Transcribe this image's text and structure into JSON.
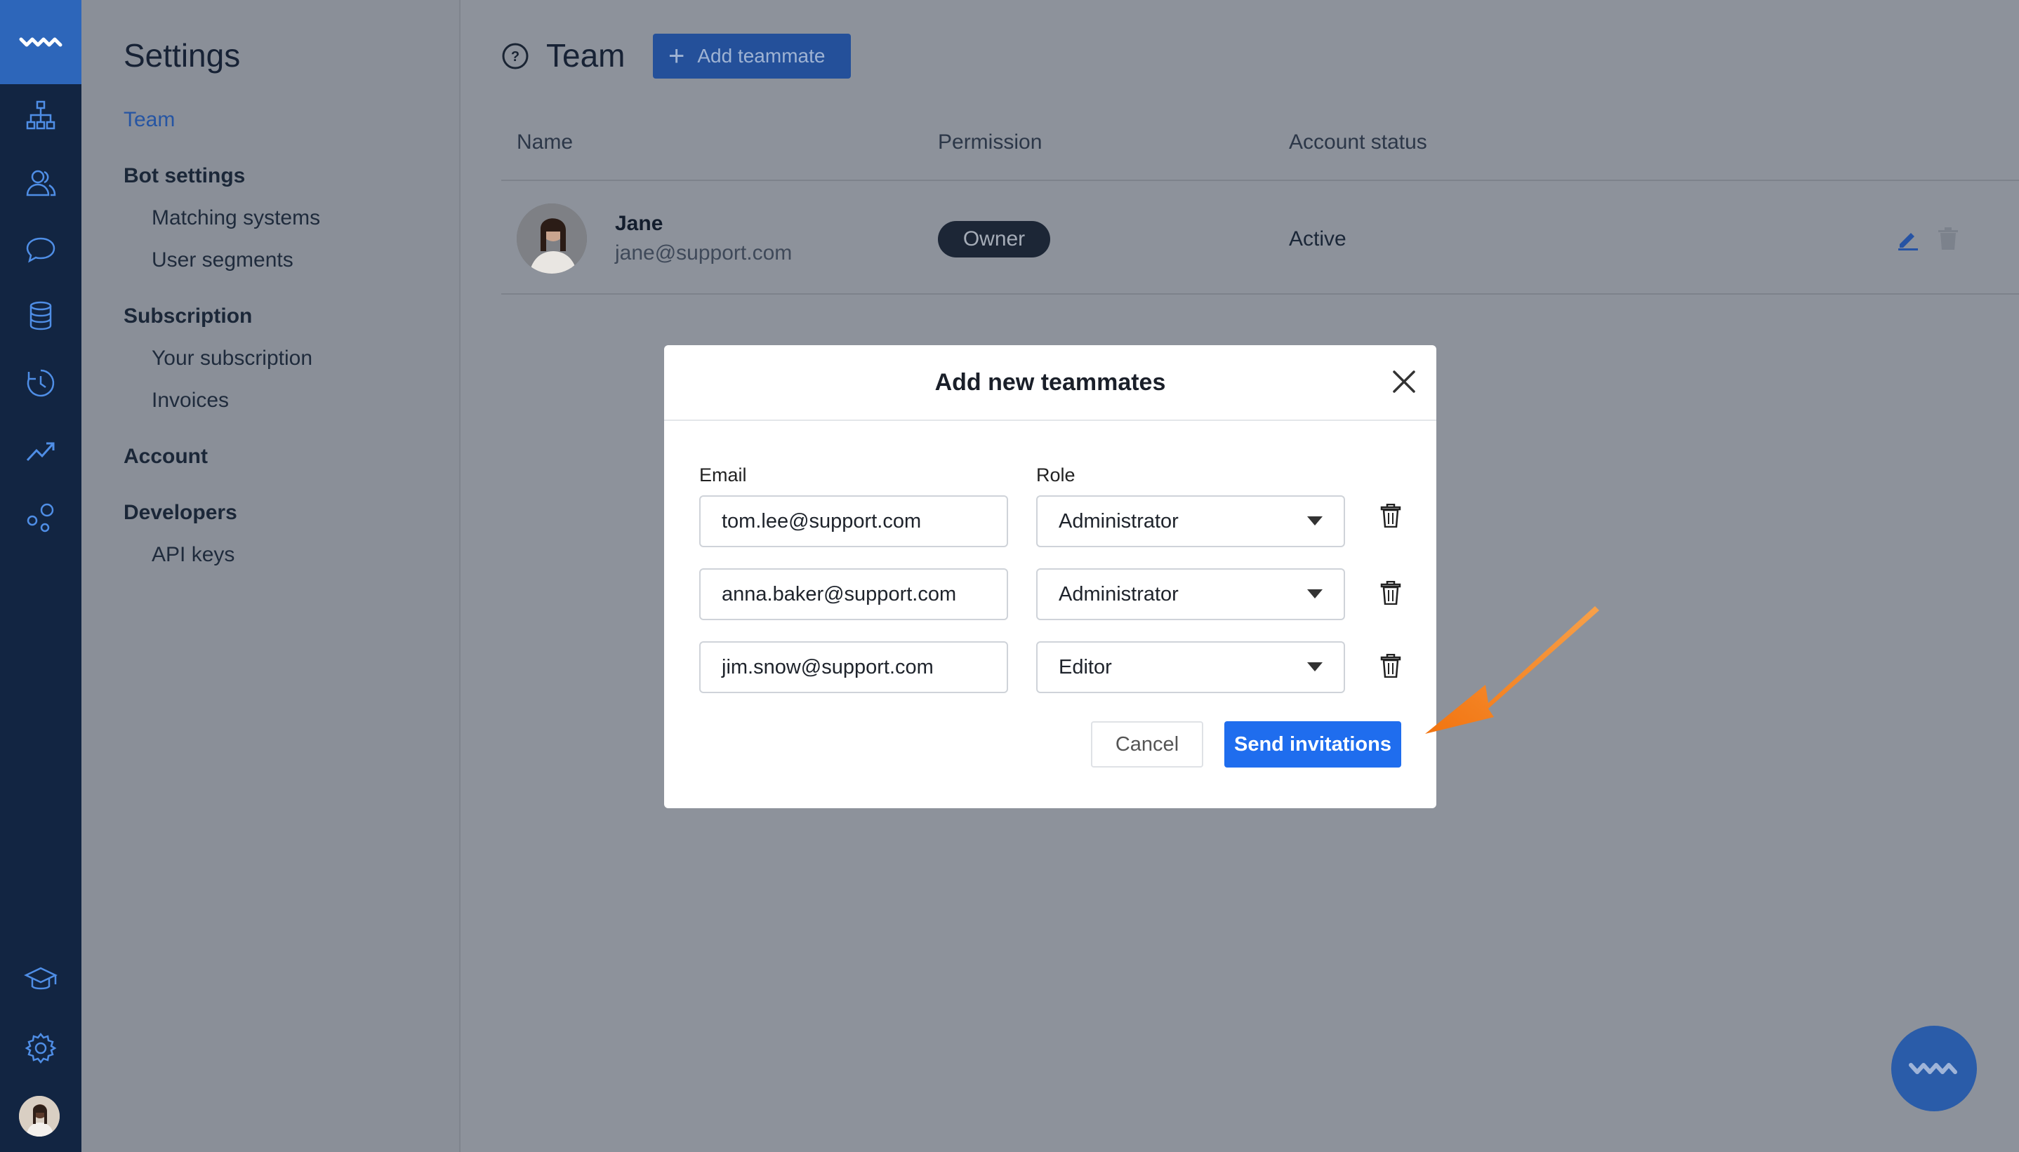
{
  "settings": {
    "title": "Settings",
    "nav": [
      {
        "label": "Team",
        "level": "top",
        "active": true
      },
      {
        "label": "Bot settings",
        "level": "top"
      },
      {
        "label": "Matching systems",
        "level": "sub"
      },
      {
        "label": "User segments",
        "level": "sub"
      },
      {
        "label": "Subscription",
        "level": "top"
      },
      {
        "label": "Your subscription",
        "level": "sub"
      },
      {
        "label": "Invoices",
        "level": "sub"
      },
      {
        "label": "Account",
        "level": "top"
      },
      {
        "label": "Developers",
        "level": "top"
      },
      {
        "label": "API keys",
        "level": "sub"
      }
    ]
  },
  "header": {
    "title": "Team",
    "add_button": "Add teammate"
  },
  "table": {
    "columns": [
      "Name",
      "Permission",
      "Account status"
    ],
    "rows": [
      {
        "name": "Jane",
        "email": "jane@support.com",
        "permission": "Owner",
        "status": "Active"
      }
    ]
  },
  "modal": {
    "title": "Add new teammates",
    "email_label": "Email",
    "role_label": "Role",
    "invites": [
      {
        "email": "tom.lee@support.com",
        "role": "Administrator"
      },
      {
        "email": "anna.baker@support.com",
        "role": "Administrator"
      },
      {
        "email": "jim.snow@support.com",
        "role": "Editor"
      }
    ],
    "cancel": "Cancel",
    "send": "Send invitations"
  },
  "colors": {
    "primary": "#1f6dee",
    "rail": "#122542",
    "annotation_arrow": "#f07a12"
  }
}
